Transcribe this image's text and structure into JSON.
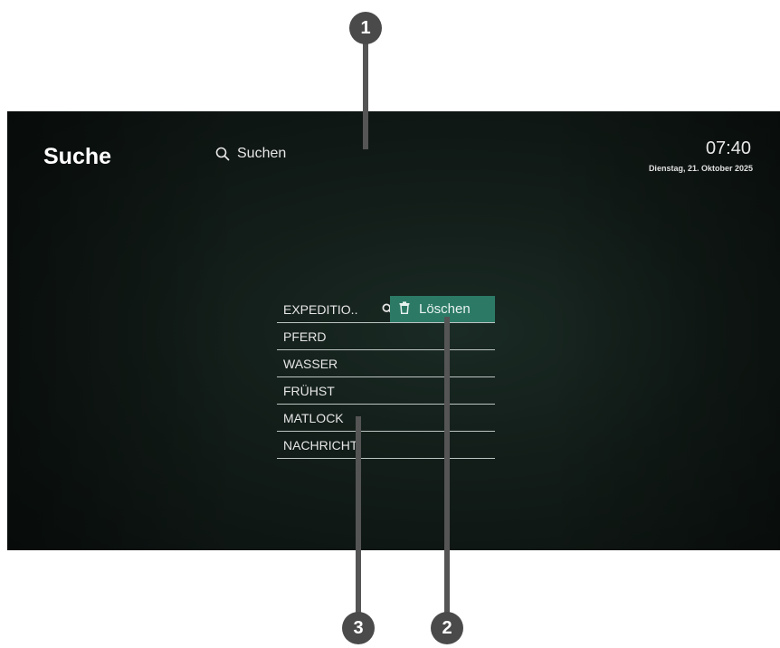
{
  "header": {
    "title": "Suche",
    "search_label": "Suchen",
    "time": "07:40",
    "date": "Dienstag, 21. Oktober 2025"
  },
  "history": {
    "items": [
      {
        "label": "EXPEDITIO.."
      },
      {
        "label": "PFERD"
      },
      {
        "label": "WASSER"
      },
      {
        "label": "FRÜHST"
      },
      {
        "label": "MATLOCK"
      },
      {
        "label": "NACHRICHT"
      }
    ],
    "delete_label": "Löschen"
  },
  "callouts": {
    "one": "1",
    "two": "2",
    "three": "3"
  },
  "colors": {
    "accent": "#2c7a66",
    "background": "#121c18",
    "callout": "#4a4a4a"
  },
  "icons": {
    "search": "search-icon",
    "delete": "trash-icon"
  }
}
